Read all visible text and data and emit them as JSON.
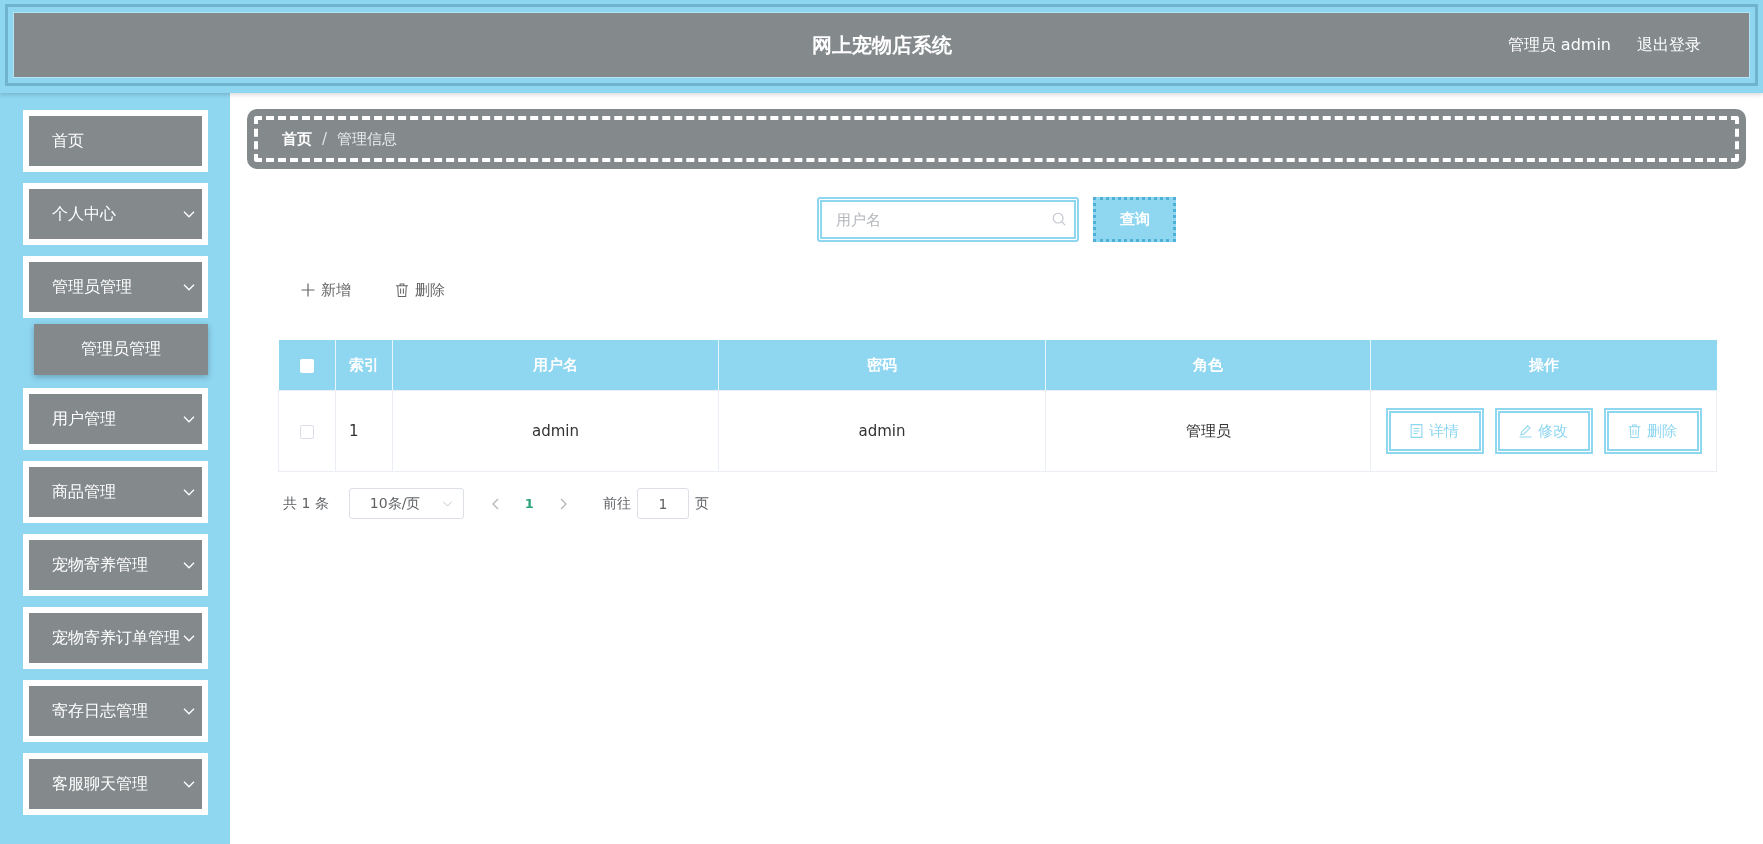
{
  "header": {
    "title": "网上宠物店系统",
    "user": "管理员 admin",
    "logout": "退出登录"
  },
  "sidebar": {
    "items": [
      {
        "label": "首页",
        "expandable": false
      },
      {
        "label": "个人中心",
        "expandable": true
      },
      {
        "label": "管理员管理",
        "expandable": true,
        "children": [
          {
            "label": "管理员管理"
          }
        ]
      },
      {
        "label": "用户管理",
        "expandable": true
      },
      {
        "label": "商品管理",
        "expandable": true
      },
      {
        "label": "宠物寄养管理",
        "expandable": true
      },
      {
        "label": "宠物寄养订单管理",
        "expandable": true
      },
      {
        "label": "寄存日志管理",
        "expandable": true
      },
      {
        "label": "客服聊天管理",
        "expandable": true
      }
    ]
  },
  "breadcrumb": {
    "separator": "/",
    "items": [
      {
        "label": "首页",
        "current": false
      },
      {
        "label": "管理信息",
        "current": true
      }
    ]
  },
  "search": {
    "placeholder": "用户名",
    "button": "查询"
  },
  "toolbar": [
    {
      "kind": "add",
      "label": "新增"
    },
    {
      "kind": "delete",
      "label": "删除"
    }
  ],
  "table": {
    "header_checkbox": {
      "checked": false
    },
    "columns": [
      "索引",
      "用户名",
      "密码",
      "角色",
      "操作"
    ],
    "rows": [
      {
        "selected": false,
        "cells": [
          "1",
          "admin",
          "admin",
          "管理员"
        ],
        "actions": [
          {
            "kind": "detail",
            "label": "详情"
          },
          {
            "kind": "edit",
            "label": "修改"
          },
          {
            "kind": "delete",
            "label": "删除"
          }
        ]
      }
    ]
  },
  "pagination": {
    "total": "共 1 条",
    "page_size": "10条/页",
    "pages": [
      {
        "label": "1",
        "selected": true
      }
    ],
    "goto_label": "前往",
    "goto_value": "1",
    "goto_suffix": "页"
  }
}
